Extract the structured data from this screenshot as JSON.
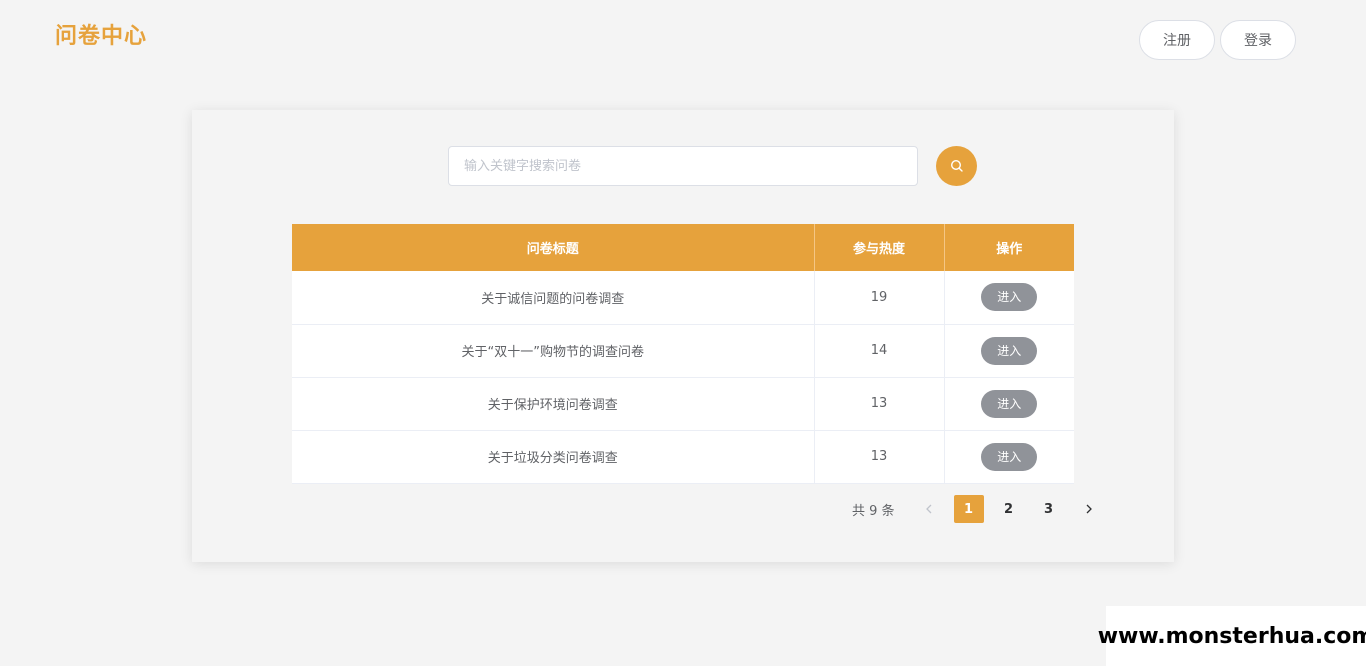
{
  "header": {
    "logo": "问卷中心",
    "register_label": "注册",
    "login_label": "登录"
  },
  "search": {
    "placeholder": "输入关键字搜索问卷",
    "value": ""
  },
  "colors": {
    "accent": "#e6a23c",
    "enter_button": "#909399",
    "background": "#f4f4f4"
  },
  "table": {
    "headers": [
      "问卷标题",
      "参与热度",
      "操作"
    ],
    "rows": [
      {
        "title": "关于诚信问题的问卷调查",
        "heat": "19",
        "action": "进入"
      },
      {
        "title": "关于“双十一”购物节的调查问卷",
        "heat": "14",
        "action": "进入"
      },
      {
        "title": "关于保护环境问卷调查",
        "heat": "13",
        "action": "进入"
      },
      {
        "title": "关于垃圾分类问卷调查",
        "heat": "13",
        "action": "进入"
      }
    ]
  },
  "pagination": {
    "total_text": "共 9 条",
    "pages": [
      "1",
      "2",
      "3"
    ],
    "current": "1",
    "prev_icon": "chevron-left-icon",
    "next_icon": "chevron-right-icon"
  },
  "watermark": "www.monsterhua.com"
}
